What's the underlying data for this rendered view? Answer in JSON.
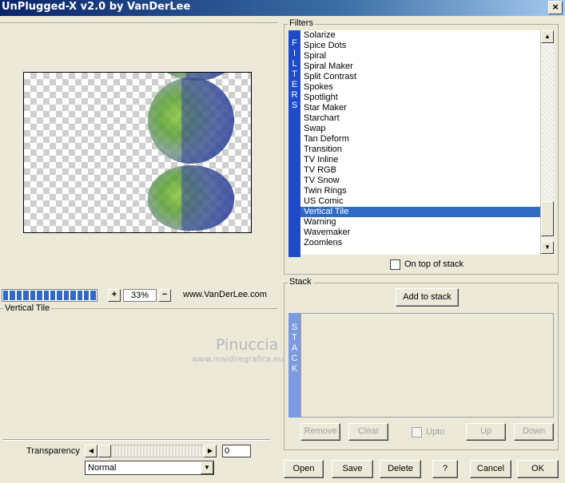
{
  "window": {
    "title": "UnPlugged-X v2.0 by VanDerLee",
    "close_glyph": "×"
  },
  "preview": {
    "zoom_plus": "+",
    "zoom_value": "33%",
    "zoom_minus": "−",
    "site": "www.VanDerLee.com"
  },
  "parameters": {
    "title": "Vertical Tile",
    "transparency_label": "Transparency",
    "transparency_value": "0",
    "blend_mode": "Normal"
  },
  "watermark": {
    "name": "Pinuccia",
    "site": "www.maidiregrafica.eu"
  },
  "filters": {
    "title": "Filters",
    "strip_letters": [
      "F",
      "I",
      "L",
      "T",
      "E",
      "R",
      "S"
    ],
    "items": [
      "Solarize",
      "Spice Dots",
      "Spiral",
      "Spiral Maker",
      "Split Contrast",
      "Spokes",
      "Spotlight",
      "Star Maker",
      "Starchart",
      "Swap",
      "Tan Deform",
      "Transition",
      "TV Inline",
      "TV RGB",
      "TV Snow",
      "Twin Rings",
      "US Comic",
      "Vertical Tile",
      "Warning",
      "Wavemaker",
      "Zoomlens"
    ],
    "selected": "Vertical Tile",
    "on_top_label": "On top of stack"
  },
  "stack": {
    "title": "Stack",
    "add_label": "Add to stack",
    "strip_letters": [
      "S",
      "T",
      "A",
      "C",
      "K"
    ],
    "remove_label": "Remove",
    "clear_label": "Clear",
    "upto_label": "Upto",
    "up_label": "Up",
    "down_label": "Down"
  },
  "footer": {
    "open_label": "Open",
    "save_label": "Save",
    "delete_label": "Delete",
    "help_label": "?",
    "cancel_label": "Cancel",
    "ok_label": "OK"
  },
  "colors": {
    "accent": "#316ac5",
    "strip": "#1e4cc8",
    "face": "#ece9d8"
  }
}
